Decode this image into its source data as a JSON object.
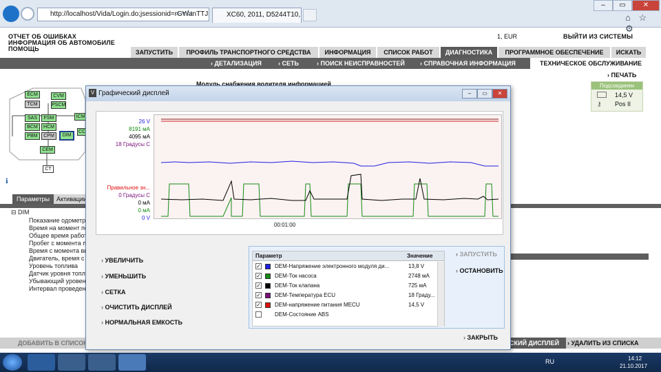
{
  "browser": {
    "url": "http://localhost/Vida/Login.do;jsessionid=rGWanTTJn",
    "tab_title": "XC60, 2011, D5244T10, M66...",
    "address_icons": "⌕ ▾ ↻",
    "header_icons": "⌂ ☆ ⚙"
  },
  "header": {
    "left_links": [
      "ОТЧЕТ ОБ ОШИБКАХ",
      "ИНФОРМАЦИЯ ОБ АВТОМОБИЛЕ",
      "ПОМОЩЬ"
    ],
    "locale": "1, EUR",
    "logout": "ВЫЙТИ ИЗ СИСТЕМЫ"
  },
  "tabs": [
    "ЗАПУСТИТЬ",
    "ПРОФИЛЬ ТРАНСПОРТНОГО СРЕДСТВА",
    "ИНФОРМАЦИЯ",
    "СПИСОК РАБОТ",
    "ДИАГНОСТИКА",
    "ПРОГРАММНОЕ ОБЕСПЕЧЕНИЕ",
    "ИСКАТЬ"
  ],
  "active_tab": "ДИАГНОСТИКА",
  "subnav": [
    "ДЕТАЛИЗАЦИЯ",
    "СЕТЬ",
    "ПОИСК НЕИСПРАВНОСТЕЙ",
    "СПРАВОЧНАЯ ИНФОРМАЦИЯ",
    "ТЕХНИЧЕСКОЕ ОБСЛУЖИВАНИЕ"
  ],
  "print_label": "ПЕЧАТЬ",
  "module_caption": "Модуль снабжения водителя информацией",
  "connection": {
    "label": "Подсоединен",
    "voltage": "14,5 V",
    "key_pos": "Pos II"
  },
  "diagram_nodes": [
    "ECM",
    "TCM",
    "CVM",
    "PSCM",
    "ICM",
    "SAS",
    "FSM",
    "BCM",
    "HCM",
    "PBM",
    "CPM",
    "DIM",
    "CC",
    "CEM",
    "CT"
  ],
  "param_tabs": [
    "Параметры",
    "Активации"
  ],
  "tree": {
    "root": "DIM",
    "items": [
      "Показание одометра",
      "Время на момент по",
      "Общее время работ",
      "Пробег с момента по",
      "Время с момента вы",
      "Двигатель, время с",
      "Уровень топлива",
      "Датчик уровня топлив",
      "Убывающий уровен",
      "Интервал проведен"
    ]
  },
  "bottom_bar": {
    "add": "ДОБАВИТЬ В СПИСОК",
    "graph": "СКИЙ ДИСПЛЕЙ",
    "remove": "УДАЛИТЬ ИЗ СПИСКА"
  },
  "graph_window": {
    "title": "Графический дисплей",
    "controls": [
      "‒",
      "▭",
      "✕"
    ],
    "y_labels_top": [
      "26 V",
      "8191 мА",
      "4095 мА",
      "18 Градусы С"
    ],
    "y_labels_bottom": [
      "Правильное зн...",
      "0 Градусы С",
      "0 мА",
      "0 мА",
      "0 V"
    ],
    "time_label": "00:01:00",
    "commands": [
      "УВЕЛИЧИТЬ",
      "УМЕНЬШИТЬ",
      "СЕТКА",
      "ОЧИСТИТЬ ДИСПЛЕЙ",
      "НОРМАЛЬНАЯ ЕМКОСТЬ"
    ],
    "right_commands": {
      "start": "ЗАПУСТИТЬ",
      "stop": "ОСТАНОВИТЬ",
      "close": "ЗАКРЫТЬ"
    },
    "table_headers": [
      "Параметр",
      "Значение"
    ],
    "rows": [
      {
        "checked": "✓",
        "color": "#1f1fe0",
        "name": "DEM-Напряжение электронного модуля ди...",
        "value": "13,8 V"
      },
      {
        "checked": "✓",
        "color": "#138a13",
        "name": "DEM-Ток насоса",
        "value": "2748 мА"
      },
      {
        "checked": "✓",
        "color": "#000000",
        "name": "DEM-Ток клапана",
        "value": "725 мА"
      },
      {
        "checked": "✓",
        "color": "#7a0f7a",
        "name": "DEM-Температура ECU",
        "value": "18 Граду..."
      },
      {
        "checked": "✓",
        "color": "#e01010",
        "name": "DEM-напряжение питания MECU",
        "value": "14,5 V"
      },
      {
        "checked": "",
        "color": "#ffffff",
        "name": "DEM-Состояние ABS",
        "value": ""
      }
    ]
  },
  "taskbar": {
    "lang": "RU",
    "time": "14:12",
    "date": "21.10.2017"
  }
}
